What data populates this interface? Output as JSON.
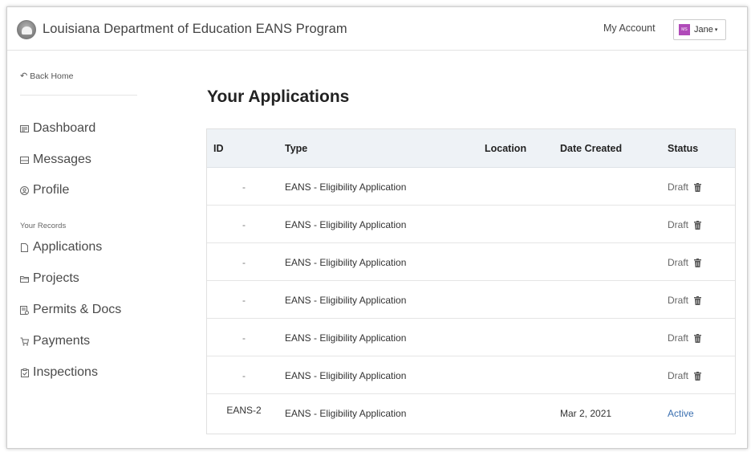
{
  "header": {
    "title": "Louisiana Department of Education EANS Program",
    "my_account": "My Account",
    "user": {
      "avatar_initials": "MS",
      "name": "Jane",
      "avatar_color": "#b04bb9"
    }
  },
  "sidebar": {
    "back_home": "Back Home",
    "nav_primary": [
      {
        "label": "Dashboard",
        "icon": "dashboard-icon"
      },
      {
        "label": "Messages",
        "icon": "messages-icon"
      },
      {
        "label": "Profile",
        "icon": "profile-icon"
      }
    ],
    "records_label": "Your Records",
    "nav_records": [
      {
        "label": "Applications",
        "icon": "document-icon"
      },
      {
        "label": "Projects",
        "icon": "folder-icon"
      },
      {
        "label": "Permits & Docs",
        "icon": "permit-icon"
      },
      {
        "label": "Payments",
        "icon": "cart-icon"
      },
      {
        "label": "Inspections",
        "icon": "clipboard-icon"
      }
    ]
  },
  "main": {
    "title": "Your Applications",
    "table": {
      "columns": [
        "ID",
        "Type",
        "Location",
        "Date Created",
        "Status"
      ],
      "rows": [
        {
          "id": "-",
          "type": "EANS - Eligibility Application",
          "location": "",
          "date": "",
          "status": "Draft"
        },
        {
          "id": "-",
          "type": "EANS - Eligibility Application",
          "location": "",
          "date": "",
          "status": "Draft"
        },
        {
          "id": "-",
          "type": "EANS - Eligibility Application",
          "location": "",
          "date": "",
          "status": "Draft"
        },
        {
          "id": "-",
          "type": "EANS - Eligibility Application",
          "location": "",
          "date": "",
          "status": "Draft"
        },
        {
          "id": "-",
          "type": "EANS - Eligibility Application",
          "location": "",
          "date": "",
          "status": "Draft"
        },
        {
          "id": "-",
          "type": "EANS - Eligibility Application",
          "location": "",
          "date": "",
          "status": "Draft"
        },
        {
          "id": "EANS-2",
          "type": "EANS - Eligibility Application",
          "location": "",
          "date": "Mar 2, 2021",
          "status": "Active"
        }
      ]
    }
  },
  "colors": {
    "accent_link": "#3a6fb0",
    "header_bg": "#eef2f6"
  }
}
